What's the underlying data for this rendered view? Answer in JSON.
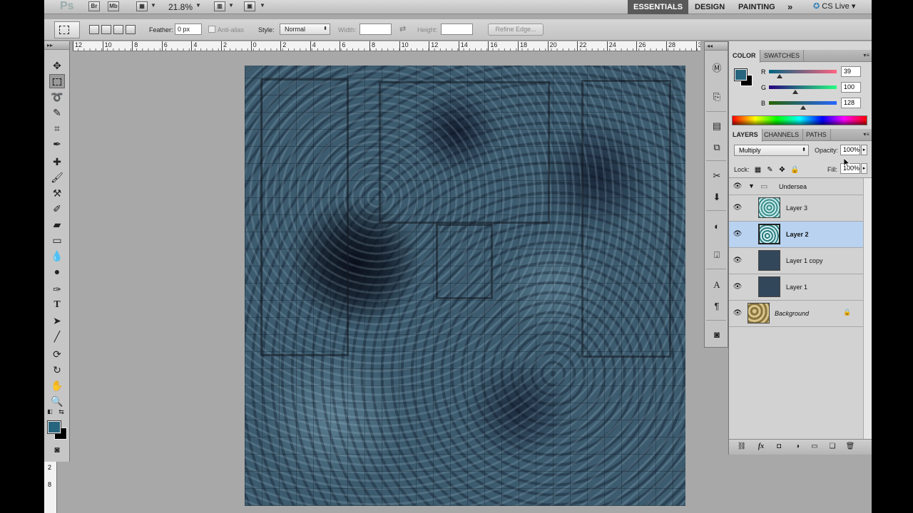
{
  "appbar": {
    "app_logo": "Ps",
    "bridge_label": "Br",
    "minibridge_label": "Mb",
    "zoom": "21.8%",
    "workspaces": [
      "ESSENTIALS",
      "DESIGN",
      "PAINTING"
    ],
    "more": "»",
    "cs_live": "CS Live"
  },
  "options": {
    "feather_label": "Feather:",
    "feather_value": "0 px",
    "antialias_label": "Anti-alias",
    "style_label": "Style:",
    "style_value": "Normal",
    "width_label": "Width:",
    "height_label": "Height:",
    "refine_edge": "Refine Edge..."
  },
  "ruler": {
    "h_labels": [
      "12",
      "10",
      "8",
      "6",
      "4",
      "2",
      "0",
      "2",
      "4",
      "6",
      "8",
      "10",
      "12",
      "14",
      "16",
      "18",
      "20",
      "22",
      "24",
      "26",
      "28",
      "30"
    ],
    "v_labels": [
      "2",
      "8"
    ]
  },
  "toolbox": {
    "tools": [
      "move-tool",
      "rectangular-marquee-tool",
      "lasso-tool",
      "quick-selection-tool",
      "crop-tool",
      "eyedropper-tool",
      "spot-healing-tool",
      "brush-tool",
      "clone-stamp-tool",
      "history-brush-tool",
      "eraser-tool",
      "gradient-tool",
      "blur-tool",
      "dodge-tool",
      "pen-tool",
      "type-tool",
      "path-selection-tool",
      "line-tool",
      "3d-rotate-tool",
      "3d-orbit-tool",
      "hand-tool",
      "zoom-tool"
    ],
    "foreground_color": "#27647d",
    "background_color": "#000000"
  },
  "color_panel": {
    "tabs": [
      "COLOR",
      "SWATCHES"
    ],
    "r_label": "R",
    "g_label": "G",
    "b_label": "B",
    "r": "39",
    "g": "100",
    "b": "128",
    "r_level": 0.153,
    "g_level": 0.392,
    "b_level": 0.502
  },
  "layers_panel": {
    "tabs": [
      "LAYERS",
      "CHANNELS",
      "PATHS"
    ],
    "blend_mode": "Multiply",
    "opacity_label": "Opacity:",
    "opacity": "100%",
    "lock_label": "Lock:",
    "fill_label": "Fill:",
    "fill": "100%",
    "group_name": "Undersea",
    "layers": [
      {
        "name": "Layer 3",
        "selected": false
      },
      {
        "name": "Layer 2",
        "selected": true
      },
      {
        "name": "Layer 1 copy",
        "selected": false
      },
      {
        "name": "Layer 1",
        "selected": false
      },
      {
        "name": "Background",
        "selected": false,
        "locked": true
      }
    ]
  }
}
